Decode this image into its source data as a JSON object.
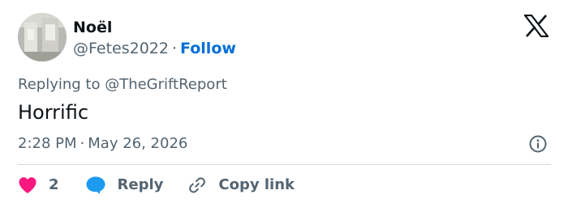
{
  "author": {
    "name": "Noël",
    "handle": "@Fetes2022",
    "separator": "·",
    "follow_label": "Follow"
  },
  "tweet": {
    "replying_prefix": "Replying to ",
    "replying_to": "@TheGriftReport",
    "text": "Horrific",
    "time": "2:28 PM",
    "date_separator": "·",
    "date": "May 26, 2026"
  },
  "actions": {
    "like_count": "2",
    "reply_label": "Reply",
    "copy_label": "Copy link"
  },
  "colors": {
    "like": "#f91880",
    "reply": "#1d9bf0",
    "follow": "#006fd6",
    "secondary_text": "#536471"
  },
  "icons": {
    "logo": "x-logo-icon",
    "info": "info-icon",
    "like": "heart-icon",
    "reply": "speech-bubble-icon",
    "copy": "link-icon"
  }
}
